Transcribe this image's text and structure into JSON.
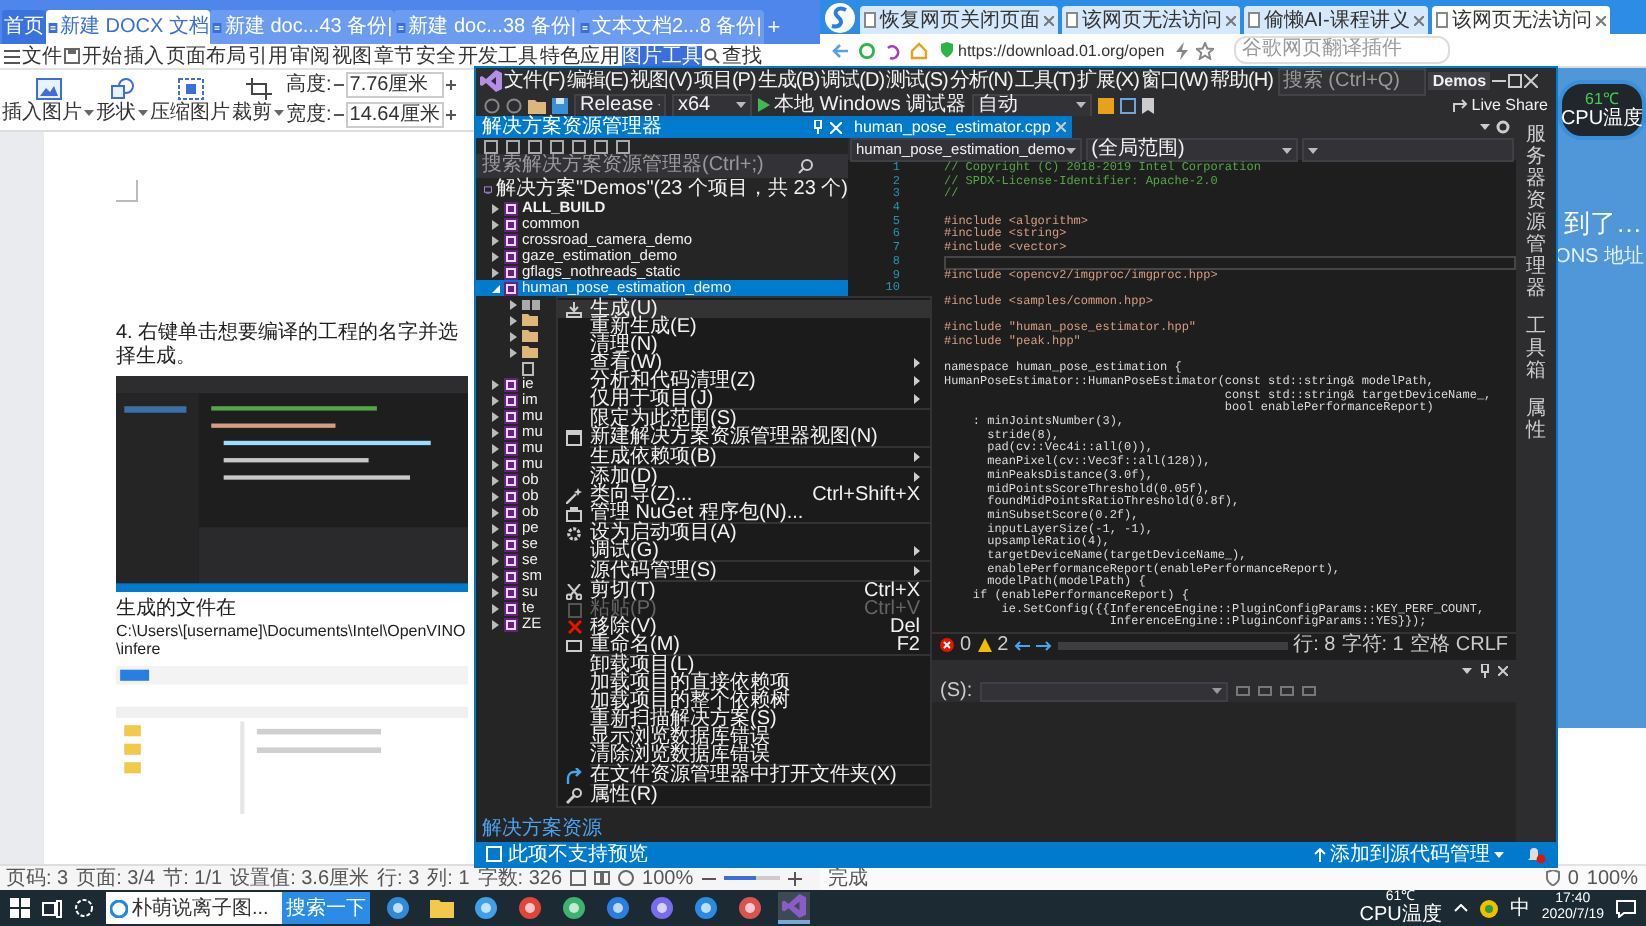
{
  "wps": {
    "tabs": [
      {
        "kind": "home",
        "label": "首页",
        "selected": false
      },
      {
        "kind": "document",
        "label": "新建 DOCX 文档",
        "selected": true
      },
      {
        "kind": "document",
        "label": "新建 doc...43 备份|",
        "selected": false
      },
      {
        "kind": "document",
        "label": "新建 doc...38 备份|",
        "selected": false
      },
      {
        "kind": "document",
        "label": "文本文档2...8 备份|",
        "selected": false
      }
    ],
    "new_tab": "+",
    "file_menu": "文件",
    "ribbon_tabs": [
      {
        "label": "开始",
        "selected": false
      },
      {
        "label": "插入",
        "selected": false
      },
      {
        "label": "页面布局",
        "selected": false
      },
      {
        "label": "引用",
        "selected": false
      },
      {
        "label": "审阅",
        "selected": false
      },
      {
        "label": "视图",
        "selected": false
      },
      {
        "label": "章节",
        "selected": false
      },
      {
        "label": "安全",
        "selected": false
      },
      {
        "label": "开发工具",
        "selected": false
      },
      {
        "label": "特色应用",
        "selected": false
      },
      {
        "label": "图片工具",
        "selected": true
      }
    ],
    "find": "查找",
    "ribbon_buttons": [
      {
        "kind": "picture",
        "label": "插入图片",
        "dropdown": true
      },
      {
        "kind": "shape",
        "label": "形状",
        "dropdown": true
      },
      {
        "kind": "compress",
        "label": "压缩图片",
        "dropdown": false
      },
      {
        "kind": "crop",
        "label": "裁剪",
        "dropdown": true
      }
    ],
    "size_fields": [
      {
        "label": "高度:",
        "value": "7.76厘米"
      },
      {
        "label": "宽度:",
        "value": "14.64厘米"
      }
    ],
    "document": {
      "step": "4. 右键单击想要编译的工程的名字并选择生成。",
      "caption": "生成的文件在",
      "path": "C:\\Users\\[username]\\Documents\\Intel\\OpenVINO\\infere"
    },
    "status": [
      "页码: 3",
      "页面: 3/4",
      "节: 1/1",
      "设置值: 3.6厘米",
      "行: 3",
      "列: 1",
      "字数: 326"
    ],
    "zoom": {
      "label": "100%",
      "level": 0.6
    }
  },
  "browser": {
    "tabs": [
      {
        "label": "恢复网页关闭页面",
        "selected": false
      },
      {
        "label": "该网页无法访问",
        "selected": false
      },
      {
        "label": "偷懒AI-课程讲义",
        "selected": false
      },
      {
        "label": "该网页无法访问",
        "selected": true
      }
    ],
    "url": "https://download.01.org/open",
    "search": {
      "placeholder": "谷歌网页翻译插件"
    },
    "headline": "到了…",
    "subline": "ONS 地址",
    "status": "完成",
    "count": "0",
    "zoom": "100%"
  },
  "vs": {
    "menu": [
      "文件(F)",
      "编辑(E)",
      "视图(V)",
      "项目(P)",
      "生成(B)",
      "调试(D)",
      "测试(S)",
      "分析(N)",
      "工具(T)",
      "扩展(X)",
      "窗口(W)",
      "帮助(H)"
    ],
    "search": {
      "placeholder": "搜索 (Ctrl+Q)"
    },
    "solution_name": "Demos",
    "toolbar": {
      "configuration": "Release",
      "platform": "x64",
      "debugger": "本地 Windows 调试器",
      "mode": "自动",
      "live_share": "Live Share"
    },
    "solution_explorer": {
      "title": "解决方案资源管理器",
      "search": {
        "placeholder": "搜索解决方案资源管理器(Ctrl+;)"
      },
      "root": "解决方案\"Demos\"(23 个项目，共 23 个)",
      "items": [
        {
          "label": "ALL_BUILD",
          "selected": false,
          "expanded": false,
          "startup": true
        },
        {
          "label": "common",
          "selected": false,
          "expanded": false,
          "startup": false
        },
        {
          "label": "crossroad_camera_demo",
          "selected": false,
          "expanded": false,
          "startup": false
        },
        {
          "label": "gaze_estimation_demo",
          "selected": false,
          "expanded": false,
          "startup": false
        },
        {
          "label": "gflags_nothreads_static",
          "selected": false,
          "expanded": false,
          "startup": false
        },
        {
          "label": "human_pose_estimation_demo",
          "selected": true,
          "expanded": true,
          "startup": false,
          "children": [
            {
              "kind": "references"
            },
            {
              "kind": "folder"
            },
            {
              "kind": "folder"
            },
            {
              "kind": "folder"
            },
            {
              "kind": "file"
            }
          ]
        },
        {
          "label": "ie",
          "selected": false,
          "expanded": false,
          "startup": false
        },
        {
          "label": "im",
          "selected": false,
          "expanded": false,
          "startup": false
        },
        {
          "label": "mu",
          "selected": false,
          "expanded": false,
          "startup": false
        },
        {
          "label": "mu",
          "selected": false,
          "expanded": false,
          "startup": false
        },
        {
          "label": "mu",
          "selected": false,
          "expanded": false,
          "startup": false
        },
        {
          "label": "mu",
          "selected": false,
          "expanded": false,
          "startup": false
        },
        {
          "label": "ob",
          "selected": false,
          "expanded": false,
          "startup": false
        },
        {
          "label": "ob",
          "selected": false,
          "expanded": false,
          "startup": false
        },
        {
          "label": "ob",
          "selected": false,
          "expanded": false,
          "startup": false
        },
        {
          "label": "pe",
          "selected": false,
          "expanded": false,
          "startup": false
        },
        {
          "label": "se",
          "selected": false,
          "expanded": false,
          "startup": false
        },
        {
          "label": "se",
          "selected": false,
          "expanded": false,
          "startup": false
        },
        {
          "label": "sm",
          "selected": false,
          "expanded": false,
          "startup": false
        },
        {
          "label": "su",
          "selected": false,
          "expanded": false,
          "startup": false
        },
        {
          "label": "te",
          "selected": false,
          "expanded": false,
          "startup": false
        },
        {
          "label": "ZE",
          "selected": false,
          "expanded": false,
          "startup": false
        }
      ],
      "bottom_tab": "解决方案资源"
    },
    "context_menu": [
      {
        "kind": "build",
        "label": "生成(U)",
        "selected": true,
        "disabled": false,
        "submenu": false
      },
      {
        "kind": "plain",
        "label": "重新生成(E)",
        "selected": false,
        "disabled": false,
        "submenu": false
      },
      {
        "kind": "plain",
        "label": "清理(N)",
        "selected": false,
        "disabled": false,
        "submenu": false
      },
      {
        "kind": "plain",
        "label": "查看(W)",
        "selected": false,
        "disabled": false,
        "submenu": true
      },
      {
        "kind": "plain",
        "label": "分析和代码清理(Z)",
        "selected": false,
        "disabled": false,
        "submenu": true
      },
      {
        "kind": "plain",
        "label": "仅用于项目(J)",
        "selected": false,
        "disabled": false,
        "submenu": true
      },
      {
        "kind": "separator"
      },
      {
        "kind": "plain",
        "label": "限定为此范围(S)",
        "selected": false,
        "disabled": false,
        "submenu": false
      },
      {
        "kind": "new-view",
        "label": "新建解决方案资源管理器视图(N)",
        "selected": false,
        "disabled": false,
        "submenu": false
      },
      {
        "kind": "separator"
      },
      {
        "kind": "plain",
        "label": "生成依赖项(B)",
        "selected": false,
        "disabled": false,
        "submenu": true
      },
      {
        "kind": "separator"
      },
      {
        "kind": "plain",
        "label": "添加(D)",
        "selected": false,
        "disabled": false,
        "submenu": true
      },
      {
        "kind": "wizard",
        "label": "类向导(Z)...",
        "shortcut": "Ctrl+Shift+X",
        "selected": false,
        "disabled": false,
        "submenu": false
      },
      {
        "kind": "package",
        "label": "管理 NuGet 程序包(N)...",
        "selected": false,
        "disabled": false,
        "submenu": false
      },
      {
        "kind": "separator"
      },
      {
        "kind": "gear",
        "label": "设为启动项目(A)",
        "selected": false,
        "disabled": false,
        "submenu": false
      },
      {
        "kind": "plain",
        "label": "调试(G)",
        "selected": false,
        "disabled": false,
        "submenu": true
      },
      {
        "kind": "separator"
      },
      {
        "kind": "plain",
        "label": "源代码管理(S)",
        "selected": false,
        "disabled": false,
        "submenu": true
      },
      {
        "kind": "separator"
      },
      {
        "kind": "cut",
        "label": "剪切(T)",
        "shortcut": "Ctrl+X",
        "selected": false,
        "disabled": false,
        "submenu": false
      },
      {
        "kind": "paste",
        "label": "粘贴(P)",
        "shortcut": "Ctrl+V",
        "selected": false,
        "disabled": true,
        "submenu": false
      },
      {
        "kind": "remove",
        "label": "移除(V)",
        "shortcut": "Del",
        "selected": false,
        "disabled": false,
        "submenu": false
      },
      {
        "kind": "rename",
        "label": "重命名(M)",
        "shortcut": "F2",
        "selected": false,
        "disabled": false,
        "submenu": false
      },
      {
        "kind": "separator"
      },
      {
        "kind": "plain",
        "label": "卸载项目(L)",
        "selected": false,
        "disabled": false,
        "submenu": false
      },
      {
        "kind": "plain",
        "label": "加载项目的直接依赖项",
        "selected": false,
        "disabled": false,
        "submenu": false
      },
      {
        "kind": "plain",
        "label": "加载项目的整个依赖树",
        "selected": false,
        "disabled": false,
        "submenu": false
      },
      {
        "kind": "plain",
        "label": "重新扫描解决方案(S)",
        "selected": false,
        "disabled": false,
        "submenu": false
      },
      {
        "kind": "plain",
        "label": "显示浏览数据库错误",
        "selected": false,
        "disabled": false,
        "submenu": false
      },
      {
        "kind": "plain",
        "label": "清除浏览数据库错误",
        "selected": false,
        "disabled": false,
        "submenu": false
      },
      {
        "kind": "separator"
      },
      {
        "kind": "open-folder",
        "label": "在文件资源管理器中打开文件夹(X)",
        "selected": false,
        "disabled": false,
        "submenu": false
      },
      {
        "kind": "separator"
      },
      {
        "kind": "wrench",
        "label": "属性(R)",
        "selected": false,
        "disabled": false,
        "submenu": false
      }
    ],
    "editor": {
      "tab": "human_pose_estimator.cpp",
      "nav": [
        "human_pose_estimation_demo",
        "(全局范围)"
      ],
      "lines": [
        {
          "no": "1",
          "kind": "comment",
          "text": "// Copyright (C) 2018-2019 Intel Corporation",
          "current": false
        },
        {
          "no": "2",
          "kind": "comment",
          "text": "// SPDX-License-Identifier: Apache-2.0",
          "current": false
        },
        {
          "no": "3",
          "kind": "comment",
          "text": "//",
          "current": false
        },
        {
          "no": "4",
          "kind": "blank",
          "current": false
        },
        {
          "no": "5",
          "kind": "directive",
          "text": "#include <algorithm>",
          "current": false
        },
        {
          "no": "6",
          "kind": "directive",
          "text": "#include <string>",
          "current": false
        },
        {
          "no": "7",
          "kind": "directive",
          "text": "#include <vector>",
          "current": false
        },
        {
          "no": "8",
          "kind": "blank",
          "current": true
        },
        {
          "no": "9",
          "kind": "directive",
          "text": "#include <opencv2/imgproc/imgproc.hpp>",
          "current": false
        },
        {
          "no": "10",
          "kind": "blank",
          "current": false
        },
        {
          "kind": "directive",
          "text": "#include <samples/common.hpp>",
          "current": false
        },
        {
          "kind": "blank",
          "current": false
        },
        {
          "kind": "directive",
          "text": "#include \"human_pose_estimator.hpp\"",
          "current": false
        },
        {
          "kind": "directive",
          "text": "#include \"peak.hpp\"",
          "current": false
        },
        {
          "kind": "blank",
          "current": false
        },
        {
          "kind": "code",
          "text": "namespace human_pose_estimation {",
          "current": false
        },
        {
          "kind": "code",
          "text": "HumanPoseEstimator::HumanPoseEstimator(const std::string& modelPath,",
          "current": false
        },
        {
          "kind": "code",
          "text": "                                       const std::string& targetDeviceName_,",
          "current": false
        },
        {
          "kind": "code",
          "text": "                                       bool enablePerformanceReport)",
          "current": false
        },
        {
          "kind": "code",
          "text": "    : minJointsNumber(3),",
          "current": false
        },
        {
          "kind": "code",
          "text": "      stride(8),",
          "current": false
        },
        {
          "kind": "code",
          "text": "      pad(cv::Vec4i::all(0)),",
          "current": false
        },
        {
          "kind": "code",
          "text": "      meanPixel(cv::Vec3f::all(128)),",
          "current": false
        },
        {
          "kind": "code",
          "text": "      minPeaksDistance(3.0f),",
          "current": false
        },
        {
          "kind": "code",
          "text": "      midPointsScoreThreshold(0.05f),",
          "current": false
        },
        {
          "kind": "code",
          "text": "      foundMidPointsRatioThreshold(0.8f),",
          "current": false
        },
        {
          "kind": "code",
          "text": "      minSubsetScore(0.2f),",
          "current": false
        },
        {
          "kind": "code",
          "text": "      inputLayerSize(-1, -1),",
          "current": false
        },
        {
          "kind": "code",
          "text": "      upsampleRatio(4),",
          "current": false
        },
        {
          "kind": "code",
          "text": "      targetDeviceName(targetDeviceName_),",
          "current": false
        },
        {
          "kind": "code",
          "text": "      enablePerformanceReport(enablePerformanceReport),",
          "current": false
        },
        {
          "kind": "code",
          "text": "      modelPath(modelPath) {",
          "current": false
        },
        {
          "kind": "code",
          "text": "    if (enablePerformanceReport) {",
          "current": false
        },
        {
          "kind": "code",
          "text": "        ie.SetConfig({{InferenceEngine::PluginConfigParams::KEY_PERF_COUNT,",
          "current": false
        },
        {
          "kind": "code",
          "text": "                       InferenceEngine::PluginConfigParams::YES}});",
          "current": false
        }
      ],
      "errors": "0",
      "warnings": "2",
      "position": [
        "行: 8",
        "字符: 1",
        "空格",
        "CRLF"
      ]
    },
    "output": {
      "source_label": "(S):"
    },
    "right_rail": [
      "服务器资源管理器",
      "工具箱",
      "属性"
    ],
    "status": {
      "message": "此项不支持预览",
      "source_control": "添加到源代码管理"
    }
  },
  "widget": {
    "temperature": "61℃",
    "label": "CPU温度"
  },
  "taskbar": {
    "search_text": "朴萌说离子图...",
    "search_button": "搜索一下",
    "apps": [
      {
        "kind": "edge",
        "active": false
      },
      {
        "kind": "folder",
        "active": false
      },
      {
        "kind": "ie",
        "active": false
      },
      {
        "kind": "chrome",
        "active": false
      },
      {
        "kind": "chat",
        "active": false
      },
      {
        "kind": "sogou",
        "active": false
      },
      {
        "kind": "shield",
        "active": false
      },
      {
        "kind": "writer",
        "active": false
      },
      {
        "kind": "paint",
        "active": false
      },
      {
        "kind": "vs",
        "active": true
      }
    ],
    "temperature": "61℃",
    "temperature_label": "CPU温度",
    "ime": "中",
    "time": "17:40",
    "date": "2020/7/19"
  }
}
